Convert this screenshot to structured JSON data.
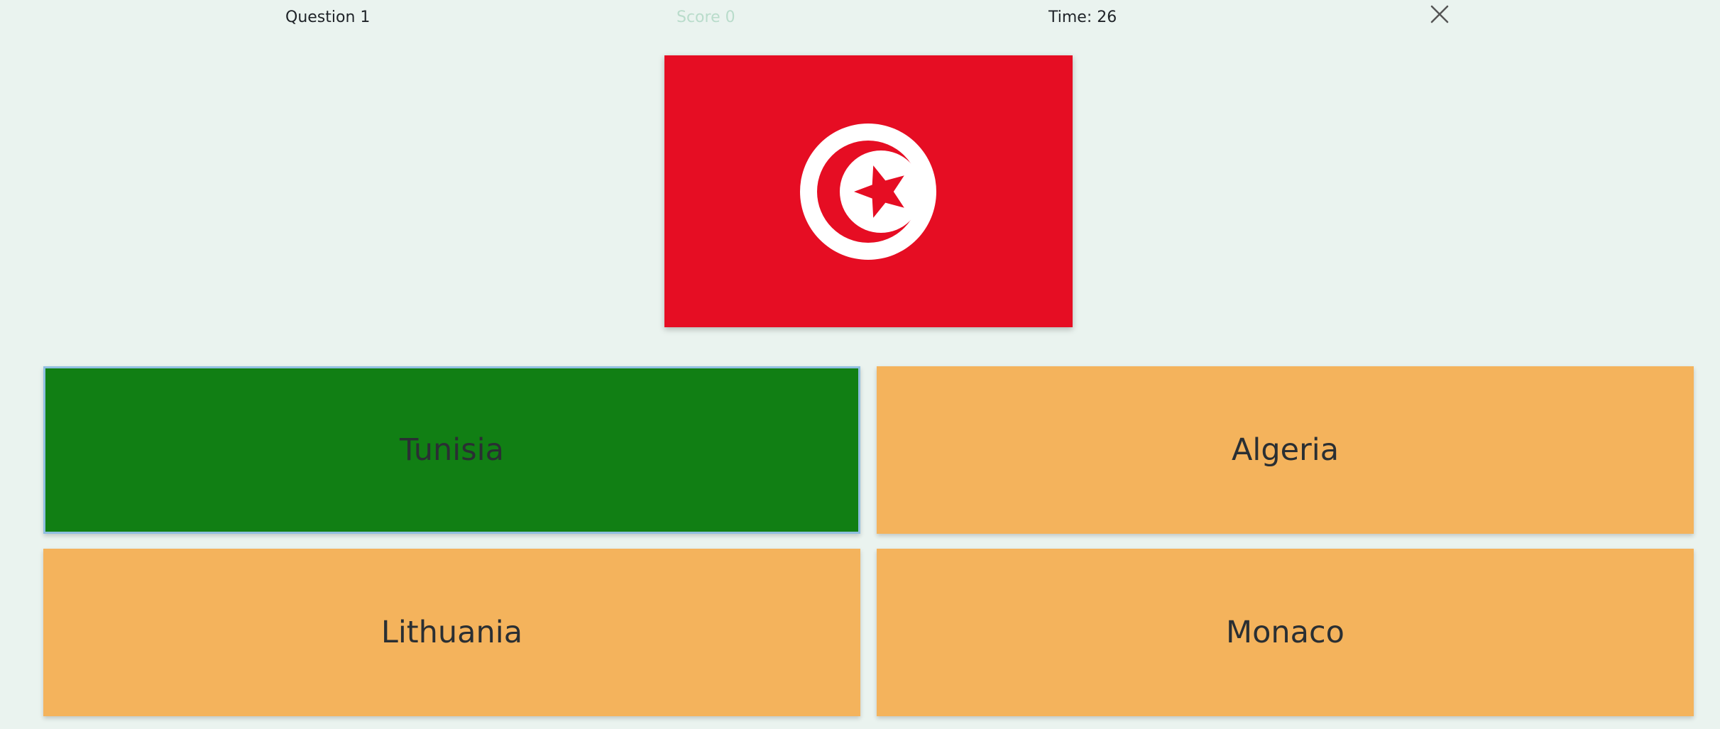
{
  "header": {
    "question": "Question 1",
    "score": "Score 0",
    "time": "Time: 26",
    "close_icon": "close-icon"
  },
  "flag": {
    "icon": "tunisia-flag",
    "background_color": "#e60d23",
    "emblem_color": "#ffffff"
  },
  "answers": [
    {
      "label": "Tunisia",
      "state": "correct",
      "color": "#117f14"
    },
    {
      "label": "Algeria",
      "state": "neutral",
      "color": "#f4b35c"
    },
    {
      "label": "Lithuania",
      "state": "neutral",
      "color": "#f4b35c"
    },
    {
      "label": "Monaco",
      "state": "neutral",
      "color": "#f4b35c"
    }
  ]
}
